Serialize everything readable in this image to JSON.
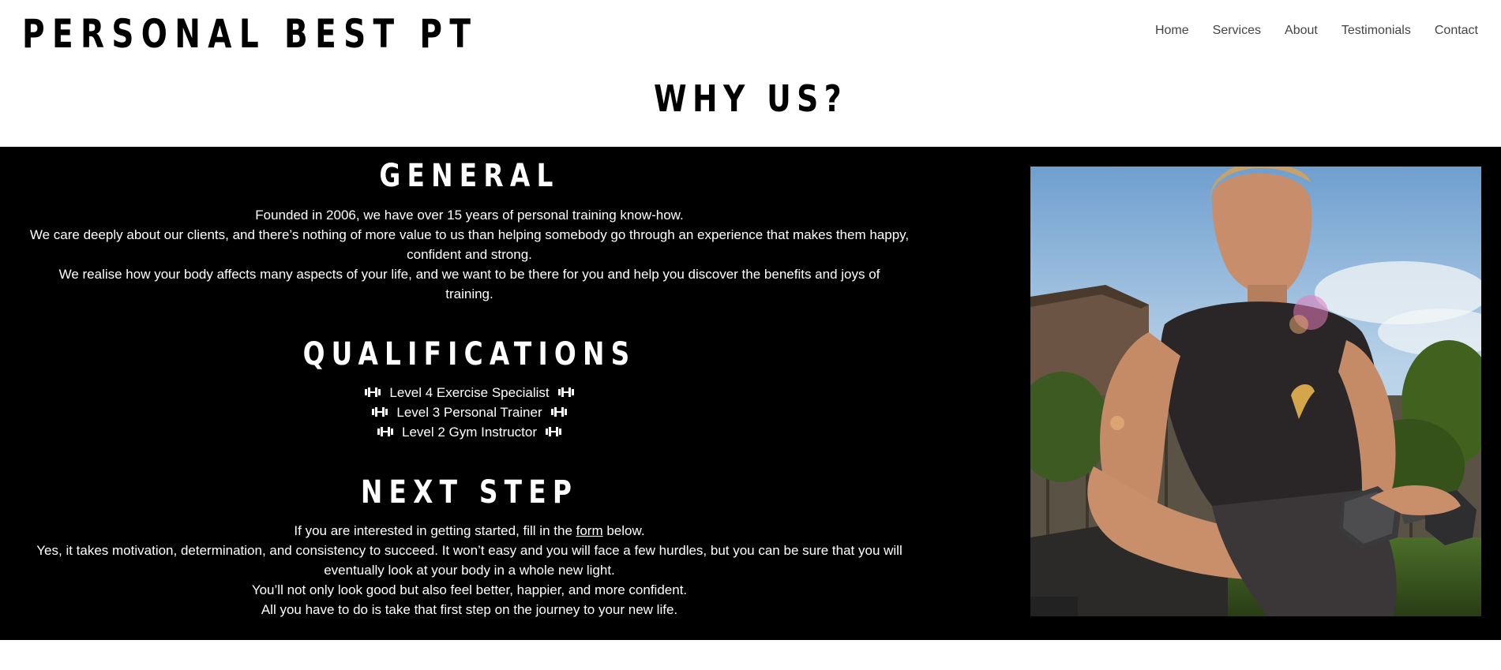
{
  "header": {
    "brand": "PERSONAL BEST PT",
    "nav": [
      "Home",
      "Services",
      "About",
      "Testimonials",
      "Contact"
    ]
  },
  "page_title": "WHY US?",
  "general": {
    "title": "GENERAL",
    "lines": [
      "Founded in 2006, we have over 15 years of personal training know-how.",
      "We care deeply about our clients, and there’s nothing of more value to us than helping somebody go through an experience that makes them happy, confident and strong.",
      "We realise how your body affects many aspects of your life, and we want to be there for you and help you discover the benefits and joys of training."
    ]
  },
  "qualifications": {
    "title": "QUALIFICATIONS",
    "items": [
      "Level 4 Exercise Specialist",
      "Level 3 Personal Trainer",
      "Level 2 Gym Instructor"
    ],
    "icon": "dumbbell-icon"
  },
  "next_step": {
    "title": "NEXT STEP",
    "line1_before": "If you are interested in getting started, fill in the ",
    "line1_link": "form",
    "line1_after": " below.",
    "lines": [
      "Yes, it takes motivation, determination, and consistency to succeed. It won’t easy and you will face a few hurdles, but you can be sure that you will eventually look at your body in a whole new light.",
      "You’ll not only look good but also feel better, happier, and more confident.",
      "All you have to do is take that first step on the journey to your new life."
    ]
  },
  "colors": {
    "band_bg": "#000000",
    "text_light": "#ffffff",
    "nav_text": "#444444"
  }
}
